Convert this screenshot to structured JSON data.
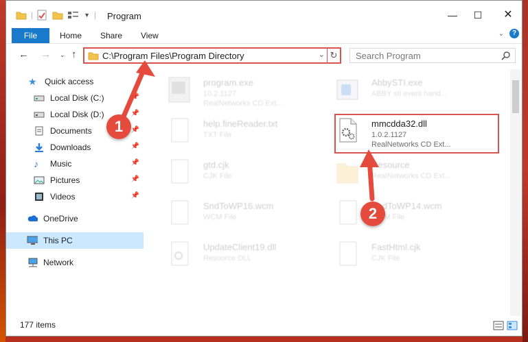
{
  "window": {
    "title": "Program"
  },
  "ribbon": {
    "tabs": [
      "File",
      "Home",
      "Share",
      "View"
    ]
  },
  "address": {
    "path": "C:\\Program Files\\Program Directory"
  },
  "search": {
    "placeholder": "Search Program"
  },
  "sidebar": {
    "items": [
      {
        "label": "Quick access",
        "icon": "star-icon"
      },
      {
        "label": "Local Disk (C:)",
        "icon": "drive-icon",
        "pinned": true
      },
      {
        "label": "Local Disk (D:)",
        "icon": "drive-icon",
        "pinned": true
      },
      {
        "label": "Documents",
        "icon": "documents-icon",
        "pinned": true
      },
      {
        "label": "Downloads",
        "icon": "download-icon",
        "pinned": true
      },
      {
        "label": "Music",
        "icon": "music-icon",
        "pinned": true
      },
      {
        "label": "Pictures",
        "icon": "pictures-icon",
        "pinned": true
      },
      {
        "label": "Videos",
        "icon": "videos-icon",
        "pinned": true
      },
      {
        "label": "OneDrive",
        "icon": "cloud-icon"
      },
      {
        "label": "This PC",
        "icon": "computer-icon",
        "selected": true
      },
      {
        "label": "Network",
        "icon": "network-icon"
      }
    ]
  },
  "files": [
    {
      "name": "program.exe",
      "line1": "10.2.1127",
      "line2": "RealNetworks CD Ext...",
      "faded": true
    },
    {
      "name": "AbbySTI.exe",
      "line1": "ABBY sti event hand...",
      "line2": "",
      "faded": true
    },
    {
      "name": "help.fineReader.txt",
      "line1": "TXT File",
      "line2": "",
      "faded": true
    },
    {
      "name": "mmcdda32.dll",
      "line1": "1.0.2.1127",
      "line2": "RealNetworks CD Ext...",
      "faded": false
    },
    {
      "name": "gtd.cjk",
      "line1": "CJK File",
      "line2": "",
      "faded": true
    },
    {
      "name": "Resource",
      "line1": "RealNetworks CD Ext...",
      "line2": "",
      "faded": true
    },
    {
      "name": "SndToWP16.wcm",
      "line1": "WCM File",
      "line2": "",
      "faded": true
    },
    {
      "name": "SndToWP14.wcm",
      "line1": "WCM File",
      "line2": "",
      "faded": true
    },
    {
      "name": "UpdateClient19.dll",
      "line1": "Resource DLL",
      "line2": "",
      "faded": true
    },
    {
      "name": "FastHtml.cjk",
      "line1": "CJK File",
      "line2": "",
      "faded": true
    }
  ],
  "status": {
    "count": "177 items"
  },
  "steps": [
    "1",
    "2"
  ],
  "colors": {
    "accent": "#1979ca",
    "highlight": "#d9534f",
    "step_badge": "#e54b3c"
  }
}
